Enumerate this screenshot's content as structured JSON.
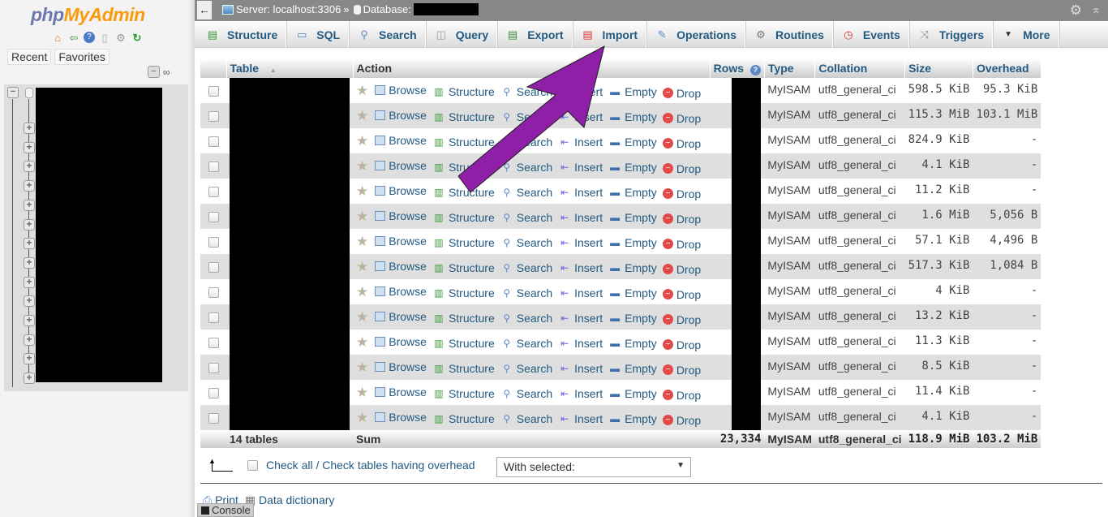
{
  "nav": {
    "logo_php": "php",
    "logo_myadmin": "MyAdmin",
    "icons": [
      "home-icon",
      "logout-icon",
      "help-icon",
      "docs-icon",
      "settings-icon",
      "reload-icon"
    ],
    "tabs": [
      "Recent",
      "Favorites"
    ],
    "tree_expanders": 15
  },
  "topbar": {
    "server_label": "Server: localhost:3306",
    "separator": "»",
    "database_label": "Database:"
  },
  "menu": [
    {
      "label": "Structure",
      "icon": "structure-icon"
    },
    {
      "label": "SQL",
      "icon": "sql-icon"
    },
    {
      "label": "Search",
      "icon": "search-icon"
    },
    {
      "label": "Query",
      "icon": "query-icon"
    },
    {
      "label": "Export",
      "icon": "export-icon"
    },
    {
      "label": "Import",
      "icon": "import-icon"
    },
    {
      "label": "Operations",
      "icon": "operations-icon"
    },
    {
      "label": "Routines",
      "icon": "routines-icon"
    },
    {
      "label": "Events",
      "icon": "events-icon"
    },
    {
      "label": "Triggers",
      "icon": "triggers-icon"
    },
    {
      "label": "More",
      "icon": "caret-down-icon"
    }
  ],
  "table": {
    "headers": {
      "table": "Table",
      "action": "Action",
      "rows": "Rows",
      "type": "Type",
      "collation": "Collation",
      "size": "Size",
      "overhead": "Overhead"
    },
    "actions": [
      "Browse",
      "Structure",
      "Search",
      "Insert",
      "Empty",
      "Drop"
    ],
    "rows": [
      {
        "type": "MyISAM",
        "collation": "utf8_general_ci",
        "size": "598.5 KiB",
        "overhead": "95.3 KiB"
      },
      {
        "type": "MyISAM",
        "collation": "utf8_general_ci",
        "size": "115.3 MiB",
        "overhead": "103.1 MiB"
      },
      {
        "type": "MyISAM",
        "collation": "utf8_general_ci",
        "size": "824.9 KiB",
        "overhead": "-"
      },
      {
        "type": "MyISAM",
        "collation": "utf8_general_ci",
        "size": "4.1 KiB",
        "overhead": "-"
      },
      {
        "type": "MyISAM",
        "collation": "utf8_general_ci",
        "size": "11.2 KiB",
        "overhead": "-"
      },
      {
        "type": "MyISAM",
        "collation": "utf8_general_ci",
        "size": "1.6 MiB",
        "overhead": "5,056 B"
      },
      {
        "type": "MyISAM",
        "collation": "utf8_general_ci",
        "size": "57.1 KiB",
        "overhead": "4,496 B"
      },
      {
        "type": "MyISAM",
        "collation": "utf8_general_ci",
        "size": "517.3 KiB",
        "overhead": "1,084 B"
      },
      {
        "type": "MyISAM",
        "collation": "utf8_general_ci",
        "size": "4 KiB",
        "overhead": "-"
      },
      {
        "type": "MyISAM",
        "collation": "utf8_general_ci",
        "size": "13.2 KiB",
        "overhead": "-"
      },
      {
        "type": "MyISAM",
        "collation": "utf8_general_ci",
        "size": "11.3 KiB",
        "overhead": "-"
      },
      {
        "type": "MyISAM",
        "collation": "utf8_general_ci",
        "size": "8.5 KiB",
        "overhead": "-"
      },
      {
        "type": "MyISAM",
        "collation": "utf8_general_ci",
        "size": "11.4 KiB",
        "overhead": "-"
      },
      {
        "type": "MyISAM",
        "collation": "utf8_general_ci",
        "size": "4.1 KiB",
        "overhead": "-"
      }
    ],
    "footer": {
      "count": "14 tables",
      "sum_label": "Sum",
      "rows_total": "23,334",
      "type": "MyISAM",
      "collation": "utf8_general_ci",
      "size": "118.9 MiB",
      "overhead": "103.2 MiB"
    }
  },
  "bulk": {
    "check_all_label": "Check all / Check tables having overhead",
    "with_selected": "With selected:"
  },
  "links": {
    "print": "Print",
    "data_dictionary": "Data dictionary"
  },
  "console_label": "Console",
  "annotation": {
    "color": "#8e1fa6",
    "points_to": "Import"
  }
}
